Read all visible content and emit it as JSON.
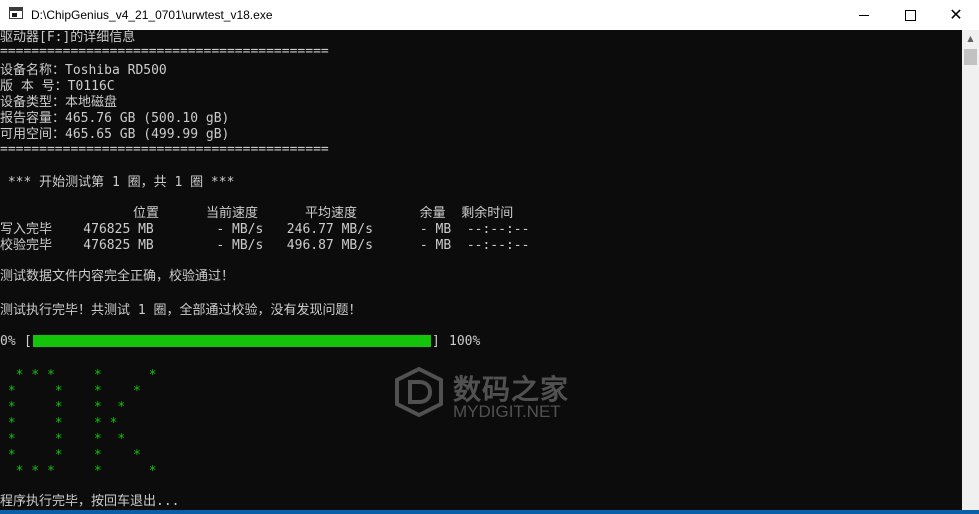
{
  "window": {
    "title": "D:\\ChipGenius_v4_21_0701\\urwtest_v18.exe",
    "minimize_icon": "minimize-icon",
    "maximize_icon": "maximize-icon",
    "close_icon": "close-icon",
    "close_glyph": "✕"
  },
  "console": {
    "header": "驱动器[F:]的详细信息",
    "separator": "==========================================",
    "device_name": "设备名称：Toshiba RD500",
    "version": "版 本 号：T0116C",
    "device_type": "设备类型：本地磁盘",
    "reported_capacity": "报告容量：465.76 GB (500.10 gB)",
    "available_space": "可用空间：465.65 GB (499.99 gB)",
    "separator2": "==========================================",
    "test_start": " *** 开始测试第 1 圈，共 1 圈 ***",
    "table": {
      "header": "                 位置      当前速度      平均速度        余量  剩余时间",
      "rows": [
        "写入完毕    476825 MB        - MB/s   246.77 MB/s      - MB  --:--:--",
        "校验完毕    476825 MB        - MB/s   496.87 MB/s      - MB  --:--:--"
      ]
    },
    "verify_ok": "测试数据文件内容完全正确，校验通过！",
    "test_done": "测试执行完毕！共测试 1 圈，全部通过校验，没有发现问题！",
    "progress": {
      "left_label": "0%",
      "right_label": "100%",
      "value": 100
    },
    "ok_art": [
      "  * * *     *      *",
      " *     *    *    *",
      " *     *    *  *",
      " *     *    * *",
      " *     *    *  *",
      " *     *    *    *",
      "  * * *     *      *"
    ],
    "exit_prompt": "程序执行完毕，按回车退出..."
  },
  "watermark": {
    "cn": "数码之家",
    "en": "MYDIGIT.NET"
  },
  "colors": {
    "console_bg": "#0c0c0c",
    "console_text": "#cccccc",
    "progress_green": "#13c40a",
    "art_green": "#13c40a",
    "titlebar_bg": "#ffffff",
    "taskbar_blue": "#0b5ea8"
  }
}
